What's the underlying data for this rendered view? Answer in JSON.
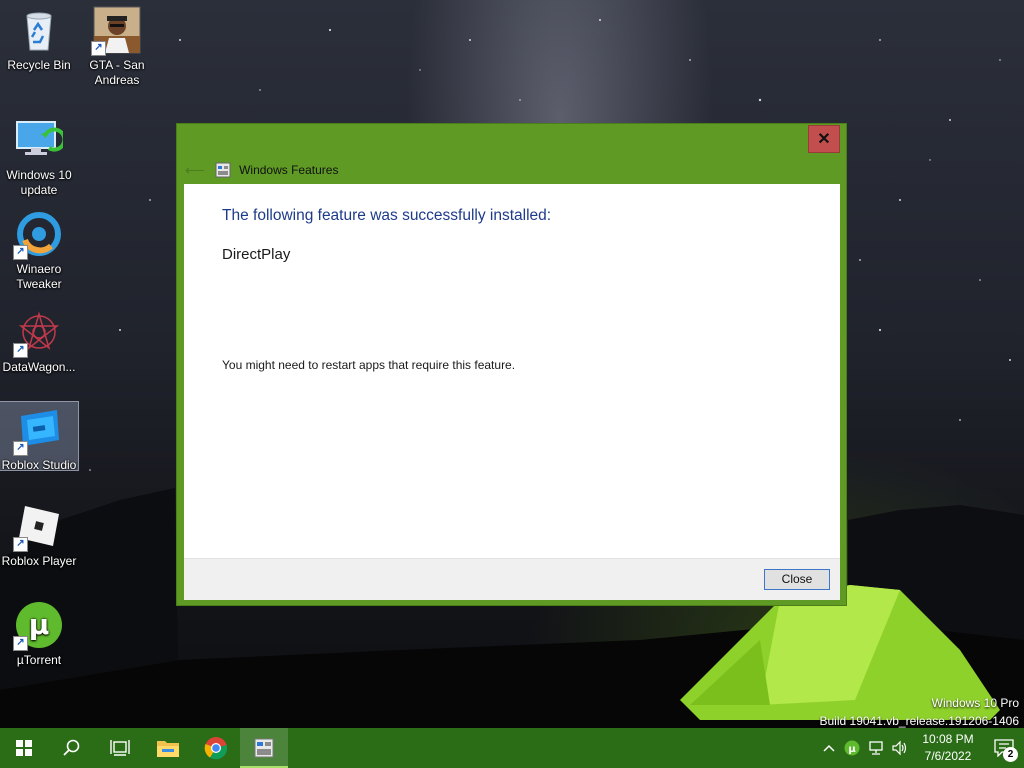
{
  "desktop": {
    "icons": [
      {
        "label": "Recycle Bin",
        "icon": "recycle-bin-icon"
      },
      {
        "label": "GTA - San Andreas",
        "icon": "gta-icon"
      },
      {
        "label": "Windows 10 update",
        "icon": "windows-update-icon"
      },
      {
        "label": "Winaero Tweaker",
        "icon": "winaero-icon"
      },
      {
        "label": "DataWagon...",
        "icon": "datawagon-icon"
      },
      {
        "label": "Roblox Studio",
        "icon": "roblox-studio-icon"
      },
      {
        "label": "Roblox Player",
        "icon": "roblox-player-icon"
      },
      {
        "label": "µTorrent",
        "icon": "utorrent-icon"
      }
    ]
  },
  "dialog": {
    "title": "Windows Features",
    "heading": "The following feature was successfully installed:",
    "feature": "DirectPlay",
    "note": "You might need to restart apps that require this feature.",
    "close_button": "Close",
    "close_x": "✕"
  },
  "watermark": {
    "line1": "Windows 10 Pro",
    "line2": "Build 19041.vb_release.191206-1406"
  },
  "taskbar": {
    "items": [
      "start-icon",
      "search-icon",
      "task-view-icon",
      "file-explorer-icon",
      "chrome-icon",
      "windows-features-icon"
    ],
    "clock_time": "10:08 PM",
    "clock_date": "7/6/2022",
    "notification_count": "2"
  },
  "colors": {
    "accent": "#5f9a24",
    "taskbar": "#2a6d16",
    "heading": "#1e3b8a"
  }
}
